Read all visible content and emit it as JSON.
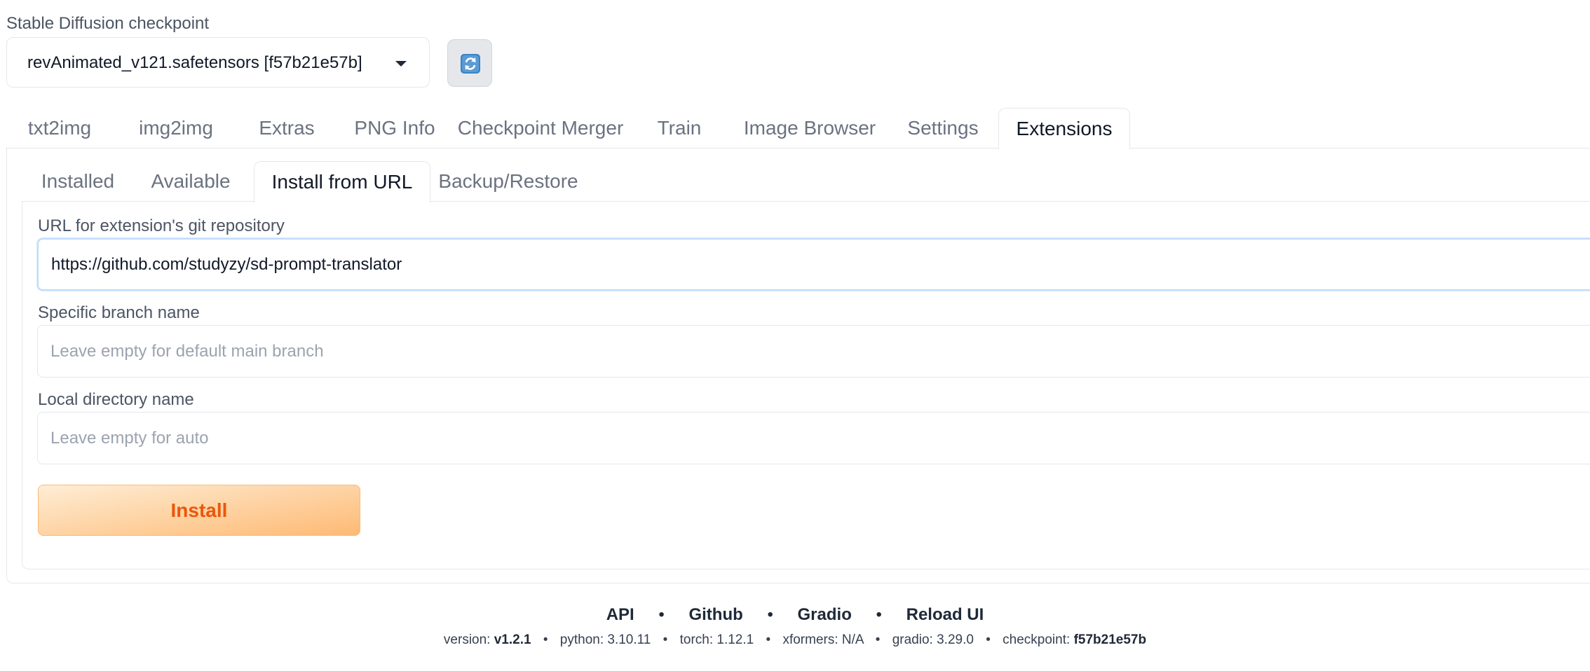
{
  "checkpoint": {
    "label": "Stable Diffusion checkpoint",
    "value": "revAnimated_v121.safetensors [f57b21e57b]",
    "refresh_icon": "refresh-icon"
  },
  "main_tabs": [
    "txt2img",
    "img2img",
    "Extras",
    "PNG Info",
    "Checkpoint Merger",
    "Train",
    "Image Browser",
    "Settings",
    "Extensions"
  ],
  "main_tab_active": "Extensions",
  "sub_tabs": [
    "Installed",
    "Available",
    "Install from URL",
    "Backup/Restore"
  ],
  "sub_tab_active": "Install from URL",
  "form": {
    "url_label": "URL for extension's git repository",
    "url_value": "https://github.com/studyzy/sd-prompt-translator",
    "branch_label": "Specific branch name",
    "branch_placeholder": "Leave empty for default main branch",
    "dir_label": "Local directory name",
    "dir_placeholder": "Leave empty for auto",
    "install_label": "Install"
  },
  "footer": {
    "links": [
      "API",
      "Github",
      "Gradio",
      "Reload UI"
    ],
    "separator": "•",
    "info": {
      "version_label": "version:",
      "version": "v1.2.1",
      "python": "python: 3.10.11",
      "torch": "torch: 1.12.1",
      "xformers": "xformers: N/A",
      "gradio": "gradio: 3.29.0",
      "checkpoint_label": "checkpoint:",
      "checkpoint": "f57b21e57b"
    }
  },
  "colors": {
    "accent": "#ea580c",
    "install_gradient_start": "#ffedd5",
    "install_gradient_end": "#fdba74",
    "focus_border": "#bfdbfe"
  }
}
